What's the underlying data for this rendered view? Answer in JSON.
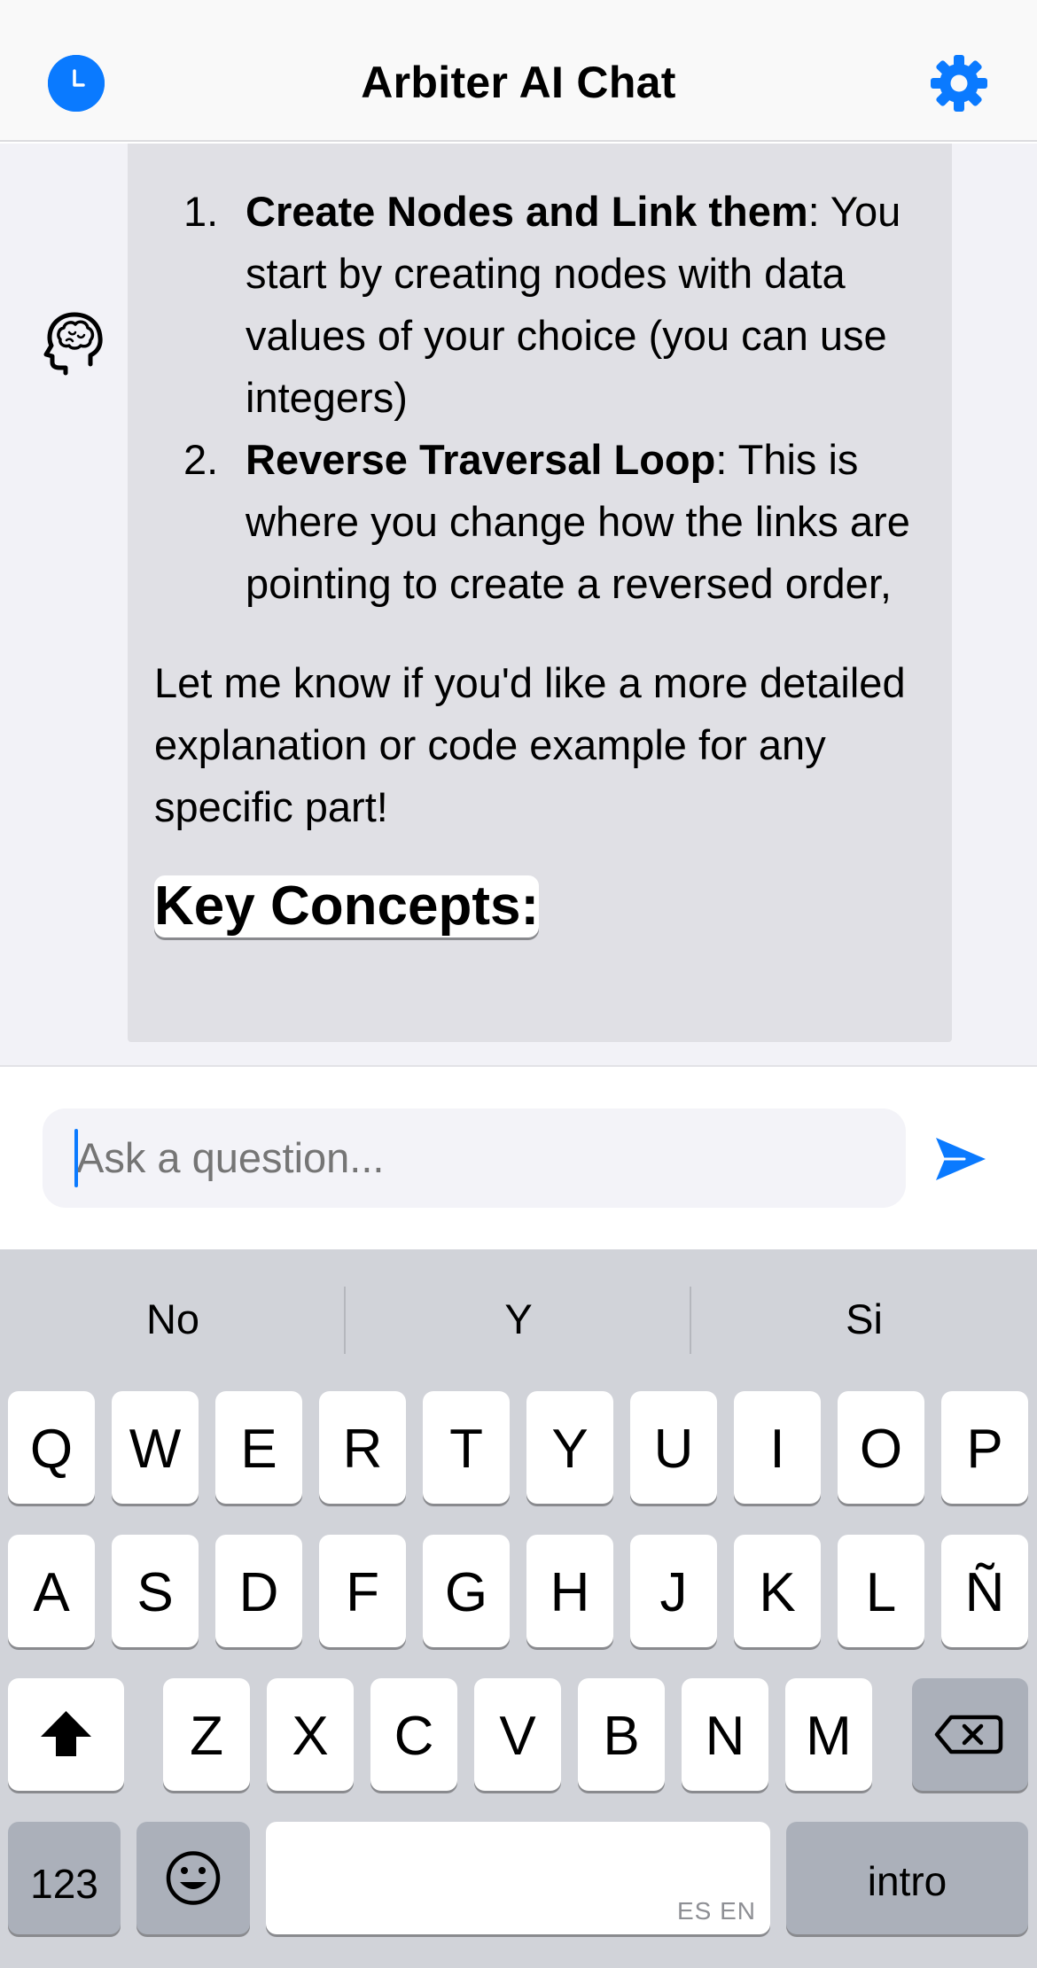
{
  "header": {
    "title": "Arbiter AI Chat",
    "left_icon": "clock-history-icon",
    "right_icon": "gear-icon",
    "accent_color": "#0a7aff"
  },
  "chat": {
    "assistant_avatar_icon": "brain-head-icon",
    "message": {
      "items": [
        {
          "number": "1.",
          "bold": "Create Nodes and Link them",
          "text": ": You start by creating nodes with data values of your choice (you can use integers)"
        },
        {
          "number": "2.",
          "bold": "Reverse Traversal Loop",
          "text": ": This is where you change how the links are pointing to create a reversed order,"
        }
      ],
      "paragraph": "Let me know if you'd like a more detailed explanation or code example for any specific part!",
      "heading": "Key Concepts:"
    }
  },
  "input": {
    "placeholder": "Ask a question...",
    "value": "",
    "send_icon": "paper-plane-icon"
  },
  "keyboard": {
    "suggestions": [
      "No",
      "Y",
      "Si"
    ],
    "row1": [
      "Q",
      "W",
      "E",
      "R",
      "T",
      "Y",
      "U",
      "I",
      "O",
      "P"
    ],
    "row2": [
      "A",
      "S",
      "D",
      "F",
      "G",
      "H",
      "J",
      "K",
      "L",
      "Ñ"
    ],
    "row3": [
      "Z",
      "X",
      "C",
      "V",
      "B",
      "N",
      "M"
    ],
    "numbers_label": "123",
    "return_label": "intro",
    "space_hint": "ES EN",
    "shift_icon": "shift-arrow-icon",
    "delete_icon": "delete-backspace-icon",
    "emoji_icon": "emoji-smile-icon"
  }
}
